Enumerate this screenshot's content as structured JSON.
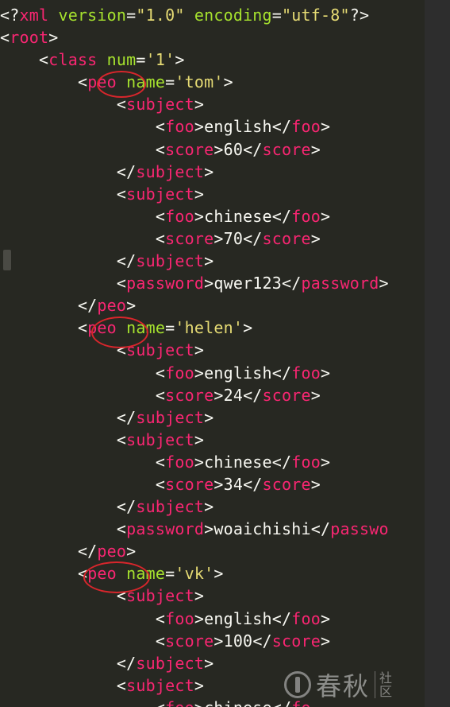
{
  "editor": {
    "language": "xml",
    "theme_colors": {
      "background": "#272822",
      "tag": "#f92672",
      "attribute": "#a6e22e",
      "string": "#e6db74",
      "text": "#f8f8f2",
      "annotation_circle": "#d8262c"
    },
    "lines": [
      [
        [
          "p",
          "<?"
        ],
        [
          "t",
          "xml"
        ],
        [
          "a",
          " version"
        ],
        [
          "p",
          "="
        ],
        [
          "s",
          "\"1.0\""
        ],
        [
          "a",
          " encoding"
        ],
        [
          "p",
          "="
        ],
        [
          "s",
          "\"utf-8\""
        ],
        [
          "p",
          "?>"
        ]
      ],
      [
        [
          "p",
          "<"
        ],
        [
          "t",
          "root"
        ],
        [
          "p",
          ">"
        ]
      ],
      [
        [
          "x",
          "    "
        ],
        [
          "p",
          "<"
        ],
        [
          "t",
          "class"
        ],
        [
          "a",
          " num"
        ],
        [
          "p",
          "="
        ],
        [
          "s",
          "'1'"
        ],
        [
          "p",
          ">"
        ]
      ],
      [
        [
          "x",
          "        "
        ],
        [
          "p",
          "<"
        ],
        [
          "t",
          "peo"
        ],
        [
          "a",
          " name"
        ],
        [
          "p",
          "="
        ],
        [
          "s",
          "'tom'"
        ],
        [
          "p",
          ">"
        ]
      ],
      [
        [
          "x",
          "            "
        ],
        [
          "p",
          "<"
        ],
        [
          "t",
          "subject"
        ],
        [
          "p",
          ">"
        ]
      ],
      [
        [
          "x",
          "                "
        ],
        [
          "p",
          "<"
        ],
        [
          "t",
          "foo"
        ],
        [
          "p",
          ">"
        ],
        [
          "x",
          "english"
        ],
        [
          "p",
          "</"
        ],
        [
          "t",
          "foo"
        ],
        [
          "p",
          ">"
        ]
      ],
      [
        [
          "x",
          "                "
        ],
        [
          "p",
          "<"
        ],
        [
          "t",
          "score"
        ],
        [
          "p",
          ">"
        ],
        [
          "x",
          "60"
        ],
        [
          "p",
          "</"
        ],
        [
          "t",
          "score"
        ],
        [
          "p",
          ">"
        ]
      ],
      [
        [
          "x",
          "            "
        ],
        [
          "p",
          "</"
        ],
        [
          "t",
          "subject"
        ],
        [
          "p",
          ">"
        ]
      ],
      [
        [
          "x",
          "            "
        ],
        [
          "p",
          "<"
        ],
        [
          "t",
          "subject"
        ],
        [
          "p",
          ">"
        ]
      ],
      [
        [
          "x",
          "                "
        ],
        [
          "p",
          "<"
        ],
        [
          "t",
          "foo"
        ],
        [
          "p",
          ">"
        ],
        [
          "x",
          "chinese"
        ],
        [
          "p",
          "</"
        ],
        [
          "t",
          "foo"
        ],
        [
          "p",
          ">"
        ]
      ],
      [
        [
          "x",
          "                "
        ],
        [
          "p",
          "<"
        ],
        [
          "t",
          "score"
        ],
        [
          "p",
          ">"
        ],
        [
          "x",
          "70"
        ],
        [
          "p",
          "</"
        ],
        [
          "t",
          "score"
        ],
        [
          "p",
          ">"
        ]
      ],
      [
        [
          "x",
          "            "
        ],
        [
          "p",
          "</"
        ],
        [
          "t",
          "subject"
        ],
        [
          "p",
          ">"
        ]
      ],
      [
        [
          "x",
          "            "
        ],
        [
          "p",
          "<"
        ],
        [
          "t",
          "password"
        ],
        [
          "p",
          ">"
        ],
        [
          "x",
          "qwer123"
        ],
        [
          "p",
          "</"
        ],
        [
          "t",
          "password"
        ],
        [
          "p",
          ">"
        ]
      ],
      [
        [
          "x",
          "        "
        ],
        [
          "p",
          "</"
        ],
        [
          "t",
          "peo"
        ],
        [
          "p",
          ">"
        ]
      ],
      [
        [
          "x",
          "        "
        ],
        [
          "p",
          "<"
        ],
        [
          "t",
          "peo"
        ],
        [
          "a",
          " name"
        ],
        [
          "p",
          "="
        ],
        [
          "s",
          "'helen'"
        ],
        [
          "p",
          ">"
        ]
      ],
      [
        [
          "x",
          "            "
        ],
        [
          "p",
          "<"
        ],
        [
          "t",
          "subject"
        ],
        [
          "p",
          ">"
        ]
      ],
      [
        [
          "x",
          "                "
        ],
        [
          "p",
          "<"
        ],
        [
          "t",
          "foo"
        ],
        [
          "p",
          ">"
        ],
        [
          "x",
          "english"
        ],
        [
          "p",
          "</"
        ],
        [
          "t",
          "foo"
        ],
        [
          "p",
          ">"
        ]
      ],
      [
        [
          "x",
          "                "
        ],
        [
          "p",
          "<"
        ],
        [
          "t",
          "score"
        ],
        [
          "p",
          ">"
        ],
        [
          "x",
          "24"
        ],
        [
          "p",
          "</"
        ],
        [
          "t",
          "score"
        ],
        [
          "p",
          ">"
        ]
      ],
      [
        [
          "x",
          "            "
        ],
        [
          "p",
          "</"
        ],
        [
          "t",
          "subject"
        ],
        [
          "p",
          ">"
        ]
      ],
      [
        [
          "x",
          "            "
        ],
        [
          "p",
          "<"
        ],
        [
          "t",
          "subject"
        ],
        [
          "p",
          ">"
        ]
      ],
      [
        [
          "x",
          "                "
        ],
        [
          "p",
          "<"
        ],
        [
          "t",
          "foo"
        ],
        [
          "p",
          ">"
        ],
        [
          "x",
          "chinese"
        ],
        [
          "p",
          "</"
        ],
        [
          "t",
          "foo"
        ],
        [
          "p",
          ">"
        ]
      ],
      [
        [
          "x",
          "                "
        ],
        [
          "p",
          "<"
        ],
        [
          "t",
          "score"
        ],
        [
          "p",
          ">"
        ],
        [
          "x",
          "34"
        ],
        [
          "p",
          "</"
        ],
        [
          "t",
          "score"
        ],
        [
          "p",
          ">"
        ]
      ],
      [
        [
          "x",
          "            "
        ],
        [
          "p",
          "</"
        ],
        [
          "t",
          "subject"
        ],
        [
          "p",
          ">"
        ]
      ],
      [
        [
          "x",
          "            "
        ],
        [
          "p",
          "<"
        ],
        [
          "t",
          "password"
        ],
        [
          "p",
          ">"
        ],
        [
          "x",
          "woaichishi"
        ],
        [
          "p",
          "</"
        ],
        [
          "t",
          "passwo"
        ]
      ],
      [
        [
          "x",
          "        "
        ],
        [
          "p",
          "</"
        ],
        [
          "t",
          "peo"
        ],
        [
          "p",
          ">"
        ]
      ],
      [
        [
          "x",
          "        "
        ],
        [
          "p",
          "<"
        ],
        [
          "t",
          "peo"
        ],
        [
          "a",
          " name"
        ],
        [
          "p",
          "="
        ],
        [
          "s",
          "'vk'"
        ],
        [
          "p",
          ">"
        ]
      ],
      [
        [
          "x",
          "            "
        ],
        [
          "p",
          "<"
        ],
        [
          "t",
          "subject"
        ],
        [
          "p",
          ">"
        ]
      ],
      [
        [
          "x",
          "                "
        ],
        [
          "p",
          "<"
        ],
        [
          "t",
          "foo"
        ],
        [
          "p",
          ">"
        ],
        [
          "x",
          "english"
        ],
        [
          "p",
          "</"
        ],
        [
          "t",
          "foo"
        ],
        [
          "p",
          ">"
        ]
      ],
      [
        [
          "x",
          "                "
        ],
        [
          "p",
          "<"
        ],
        [
          "t",
          "score"
        ],
        [
          "p",
          ">"
        ],
        [
          "x",
          "100"
        ],
        [
          "p",
          "</"
        ],
        [
          "t",
          "score"
        ],
        [
          "p",
          ">"
        ]
      ],
      [
        [
          "x",
          "            "
        ],
        [
          "p",
          "</"
        ],
        [
          "t",
          "subject"
        ],
        [
          "p",
          ">"
        ]
      ],
      [
        [
          "x",
          "            "
        ],
        [
          "p",
          "<"
        ],
        [
          "t",
          "subject"
        ],
        [
          "p",
          ">"
        ]
      ],
      [
        [
          "x",
          "                "
        ],
        [
          "p",
          "<"
        ],
        [
          "t",
          "foo"
        ],
        [
          "p",
          ">"
        ],
        [
          "x",
          "chinese"
        ],
        [
          "p",
          "</"
        ],
        [
          "t",
          "fo"
        ]
      ]
    ]
  },
  "watermark": {
    "text": "春秋",
    "sub": "社区"
  }
}
